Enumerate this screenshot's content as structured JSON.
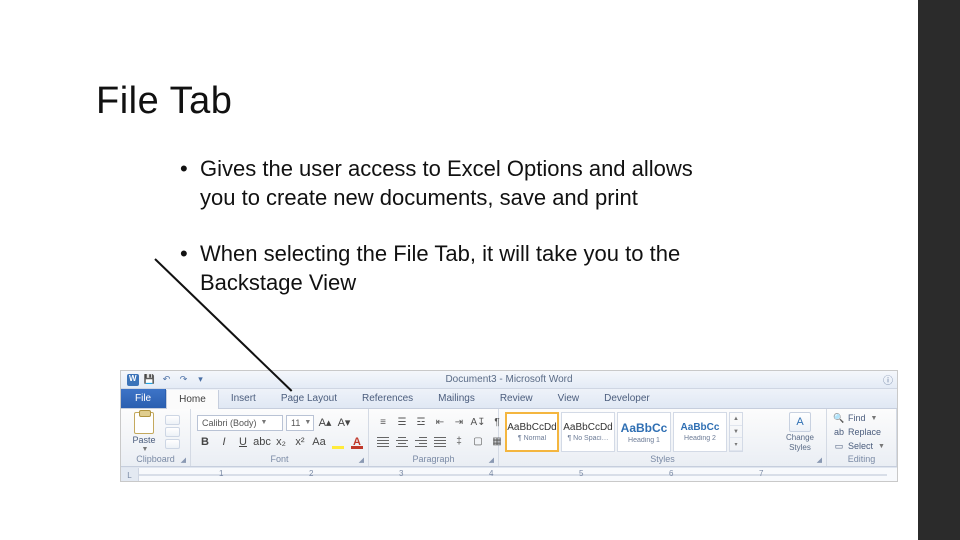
{
  "slide": {
    "title": "File Tab",
    "bullets": [
      "Gives the user access to Excel Options and allows you to create new documents, save and print",
      "When selecting the File Tab, it will take you to the Backstage View"
    ]
  },
  "word": {
    "title": "Document3 - Microsoft Word",
    "qat": {
      "save": "💾",
      "undo": "↶",
      "redo": "↷",
      "customize": "▾"
    },
    "fileTabLabel": "File",
    "tabs": [
      "Home",
      "Insert",
      "Page Layout",
      "References",
      "Mailings",
      "Review",
      "View",
      "Developer"
    ],
    "activeTab": "Home",
    "clipboard": {
      "paste": "Paste",
      "label": "Clipboard"
    },
    "font": {
      "name": "Calibri (Body)",
      "size": "11",
      "label": "Font"
    },
    "paragraph": {
      "label": "Paragraph"
    },
    "styles": {
      "label": "Styles",
      "changeLine1": "Change",
      "changeLine2": "Styles",
      "items": [
        {
          "preview": "AaBbCcDd",
          "name": "¶ Normal",
          "cls": "",
          "selected": true
        },
        {
          "preview": "AaBbCcDd",
          "name": "¶ No Spaci…",
          "cls": "",
          "selected": false
        },
        {
          "preview": "AaBbCc",
          "name": "Heading 1",
          "cls": "boldblue",
          "selected": false
        },
        {
          "preview": "AaBbCc",
          "name": "Heading 2",
          "cls": "blue",
          "selected": false
        }
      ]
    },
    "editing": {
      "label": "Editing",
      "find": "Find",
      "replace": "Replace",
      "select": "Select"
    },
    "ruler": {
      "numbers": [
        "1",
        "2",
        "3",
        "4",
        "5",
        "6",
        "7"
      ]
    }
  }
}
